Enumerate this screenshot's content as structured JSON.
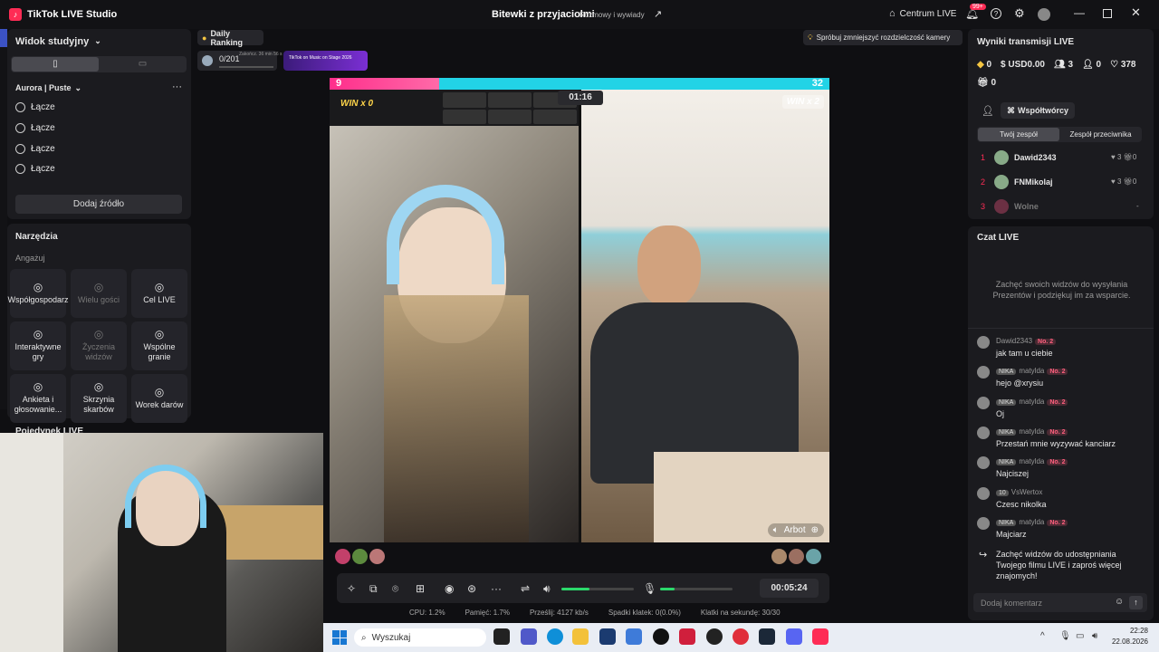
{
  "app": {
    "title": "TikTok LIVE Studio",
    "center_title": "Bitewki z przyjaciolmi",
    "center_subtitle": "Rozmowy i wywiady",
    "live_center": "Centrum LIVE",
    "notif_count": "99+"
  },
  "left": {
    "view_label": "Widok studyjny",
    "scene_name": "Aurora | Puste",
    "sources": [
      "Łącze",
      "Łącze",
      "Łącze",
      "Łącze"
    ],
    "add_source": "Dodaj źródło",
    "tools_title": "Narzędzia",
    "engage_label": "Angażuj",
    "tools": [
      {
        "label": "Współgospodarz",
        "icon": "cohost-icon",
        "disabled": false
      },
      {
        "label": "Wielu gości",
        "icon": "multi-guest-icon",
        "disabled": true
      },
      {
        "label": "Cel LIVE",
        "icon": "goal-icon",
        "disabled": false
      },
      {
        "label": "Interaktywne gry",
        "icon": "game-icon",
        "disabled": false
      },
      {
        "label": "Życzenia widzów",
        "icon": "wishes-icon",
        "disabled": true
      },
      {
        "label": "Wspólne granie",
        "icon": "coplay-icon",
        "disabled": false
      },
      {
        "label": "Ankieta i głosowanie...",
        "icon": "poll-icon",
        "disabled": false
      },
      {
        "label": "Skrzynia skarbów",
        "icon": "treasure-icon",
        "disabled": false
      },
      {
        "label": "Worek darów",
        "icon": "gift-bag-icon",
        "disabled": false
      }
    ],
    "duel_label": "Pojedynek LIVE"
  },
  "top": {
    "daily_ranking": "Daily Ranking",
    "rank_progress": "0/201",
    "rank_time": "Zakończ. 36 min 56 s",
    "banner": "TikTok on Music on Stage 2026",
    "tip": "Spróbuj zmniejszyć rozdzielczość kamery"
  },
  "battle": {
    "score_left": "9",
    "score_right": "32",
    "win_left": "WIN x 0",
    "win_right": "WIN x 2",
    "timer": "01:16",
    "opponent": "Arbot",
    "share_left": 0.22
  },
  "controls": {
    "elapsed": "00:05:24",
    "volume": 0.7,
    "mic": 0.2
  },
  "stats": {
    "cpu": "CPU:  1.2%",
    "mem": "Pamięć:  1.7%",
    "bitrate": "Prześlij:  4127 kb/s",
    "drops": "Spadki klatek:  0(0.0%)",
    "fps": "Klatki na sekundę:  30/30"
  },
  "right": {
    "results_title": "Wyniki transmisji LIVE",
    "stats": [
      "0",
      "USD0.00",
      "3",
      "0",
      "378",
      "0"
    ],
    "collab_btn": "Współtwórcy",
    "tab_your": "Twój zespół",
    "tab_opp": "Zespół przeciwnika",
    "team": [
      {
        "rank": "1",
        "name": "Dawid2343",
        "likes": "3",
        "gifts": "0"
      },
      {
        "rank": "2",
        "name": "FNMikolaj",
        "likes": "3",
        "gifts": "0"
      },
      {
        "rank": "3",
        "name": "Wolne",
        "likes": "-",
        "gifts": ""
      }
    ],
    "chat_title": "Czat LIVE",
    "chat_empty": "Zachęć swoich widzów do wysyłania Prezentów i podziękuj im za wsparcie.",
    "chat": [
      {
        "badge": "",
        "name": "Dawid2343",
        "rank": "No. 2",
        "msg": "jak tam u ciebie"
      },
      {
        "badge": "NIKA",
        "name": "matylda",
        "rank": "No. 2",
        "msg": "hejo @xrysiu"
      },
      {
        "badge": "NIKA",
        "name": "matylda",
        "rank": "No. 2",
        "msg": "Oj"
      },
      {
        "badge": "NIKA",
        "name": "matylda",
        "rank": "No. 2",
        "msg": "Przestań mnie wyzywać kanciarz"
      },
      {
        "badge": "NIKA",
        "name": "matylda",
        "rank": "No. 2",
        "msg": "Najciszej"
      },
      {
        "badge": "10",
        "name": "VsWertox",
        "rank": "",
        "msg": "Czesc nikolka"
      },
      {
        "badge": "NIKA",
        "name": "matylda",
        "rank": "No. 2",
        "msg": "Majciarz"
      }
    ],
    "share_prompt": "Zachęć widzów do udostępniania Twojego filmu LIVE i zaproś więcej znajomych!",
    "comment_placeholder": "Dodaj komentarz"
  },
  "taskbar": {
    "search": "Wyszukaj",
    "time": "22:28",
    "date": "22.08.2026"
  },
  "colors": {
    "accent": "#fe2c55",
    "battle_left": "#ff2e8b",
    "battle_right": "#22d3e6"
  }
}
